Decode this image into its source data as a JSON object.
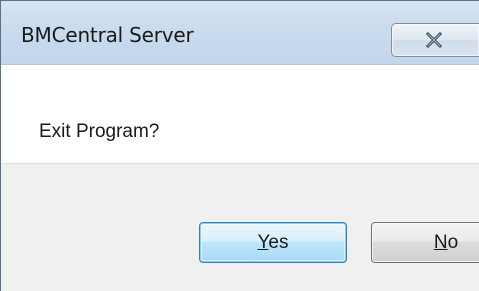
{
  "window": {
    "title": "BMCentral Server"
  },
  "titlebar": {
    "close_icon": "close-icon"
  },
  "dialog": {
    "message": "Exit Program?"
  },
  "buttons": {
    "yes": {
      "label": "Yes",
      "mnemonic": "Y",
      "rest": "es",
      "default": true
    },
    "no": {
      "label": "No",
      "mnemonic": "N",
      "rest": "o",
      "default": false
    }
  },
  "colors": {
    "titlebar": "#cadbee",
    "default_button_border": "#3c7fb1",
    "footer": "#f0f0f0"
  }
}
